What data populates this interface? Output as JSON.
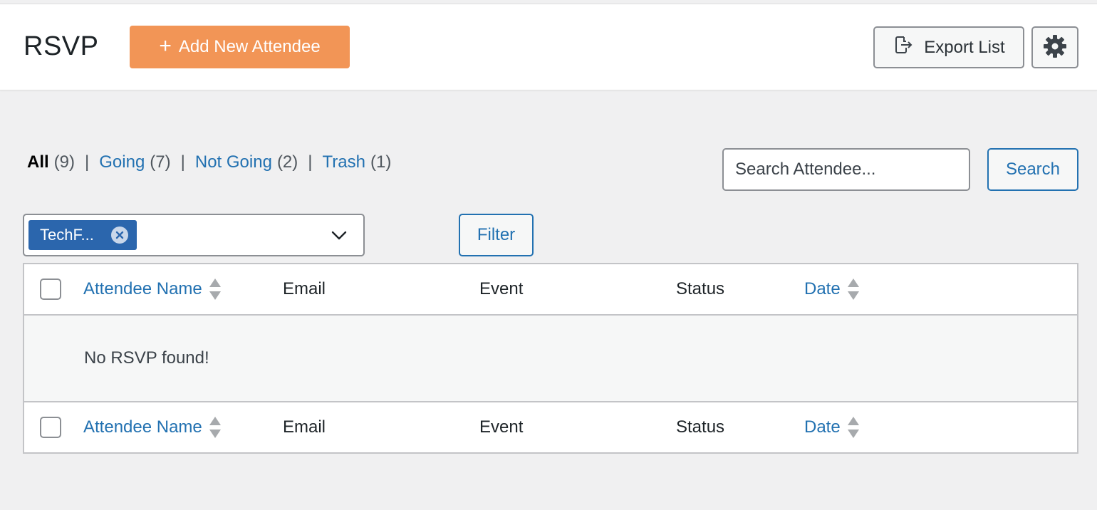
{
  "header": {
    "title": "RSVP",
    "add_button": {
      "icon": "+",
      "label": "Add New Attendee"
    },
    "export_button": {
      "icon": "export-icon",
      "label": "Export List"
    },
    "settings_button": {
      "icon": "gear-icon"
    }
  },
  "views": [
    {
      "label": "All",
      "count": "(9)",
      "current": true
    },
    {
      "label": "Going",
      "count": "(7)",
      "current": false
    },
    {
      "label": "Not Going",
      "count": "(2)",
      "current": false
    },
    {
      "label": "Trash",
      "count": "(1)",
      "current": false
    }
  ],
  "search": {
    "placeholder": "Search Attendee...",
    "value": "",
    "button_label": "Search"
  },
  "event_filter": {
    "selected_chip": "TechF...",
    "button_label": "Filter"
  },
  "table": {
    "columns": [
      {
        "label": "Attendee Name",
        "sortable": true
      },
      {
        "label": "Email",
        "sortable": false
      },
      {
        "label": "Event",
        "sortable": false
      },
      {
        "label": "Status",
        "sortable": false
      },
      {
        "label": "Date",
        "sortable": true
      }
    ],
    "rows": [],
    "empty_message": "No RSVP found!"
  },
  "colors": {
    "accent": "#f29556",
    "link": "#2271b1",
    "chip": "#2b66ad",
    "background": "#f0f0f1"
  }
}
